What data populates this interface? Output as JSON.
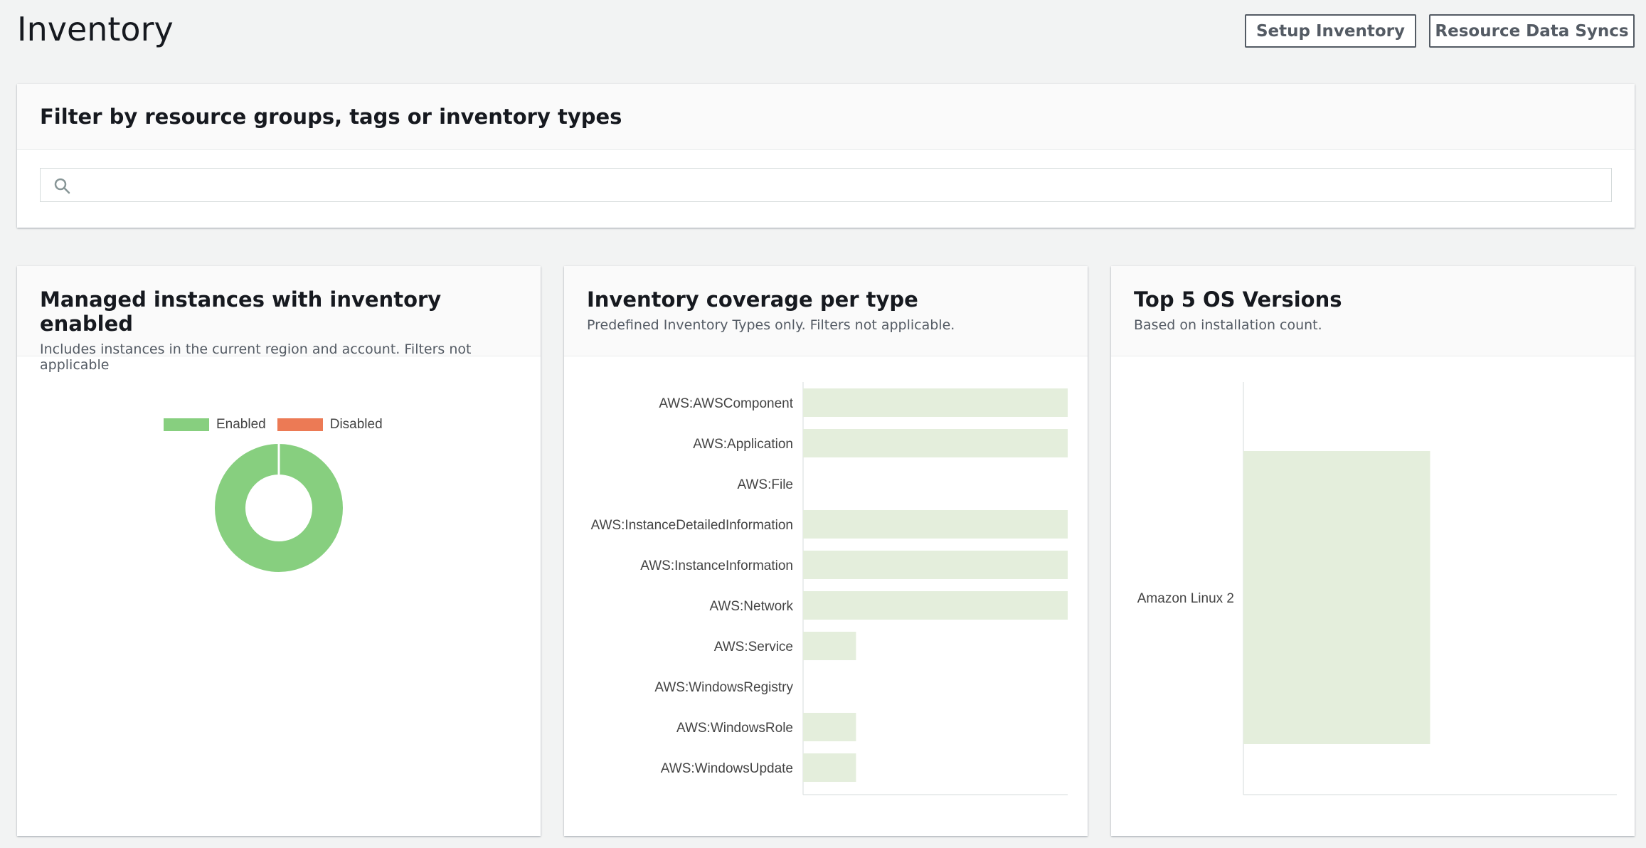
{
  "page": {
    "title": "Inventory"
  },
  "header_buttons": {
    "setup": "Setup Inventory",
    "syncs": "Resource Data Syncs"
  },
  "filter": {
    "title": "Filter by resource groups, tags or inventory types",
    "placeholder": ""
  },
  "managed_instances": {
    "title": "Managed instances with inventory enabled",
    "subtitle": "Includes instances in the current region and account. Filters not applicable",
    "chart_data": {
      "type": "pie",
      "variant": "donut",
      "legend": [
        "Enabled",
        "Disabled"
      ],
      "values": [
        1,
        0
      ],
      "colors": [
        "#87cf7f",
        "#ec7a55"
      ],
      "legend_position": "top"
    }
  },
  "coverage": {
    "title": "Inventory coverage per type",
    "subtitle": "Predefined Inventory Types only. Filters not applicable.",
    "chart_data": {
      "type": "bar",
      "orientation": "horizontal",
      "categories": [
        "AWS:AWSComponent",
        "AWS:Application",
        "AWS:File",
        "AWS:InstanceDetailedInformation",
        "AWS:InstanceInformation",
        "AWS:Network",
        "AWS:Service",
        "AWS:WindowsRegistry",
        "AWS:WindowsRole",
        "AWS:WindowsUpdate"
      ],
      "values": [
        100,
        100,
        0,
        100,
        100,
        100,
        20,
        0,
        20,
        20
      ],
      "xlim": [
        0,
        100
      ],
      "color": "#e4eedc"
    }
  },
  "os_versions": {
    "title": "Top 5 OS Versions",
    "subtitle": "Based on installation count.",
    "chart_data": {
      "type": "bar",
      "orientation": "horizontal",
      "categories": [
        "Amazon Linux 2"
      ],
      "values": [
        1
      ],
      "xlim": [
        0,
        2
      ],
      "color": "#e4eedc"
    }
  }
}
